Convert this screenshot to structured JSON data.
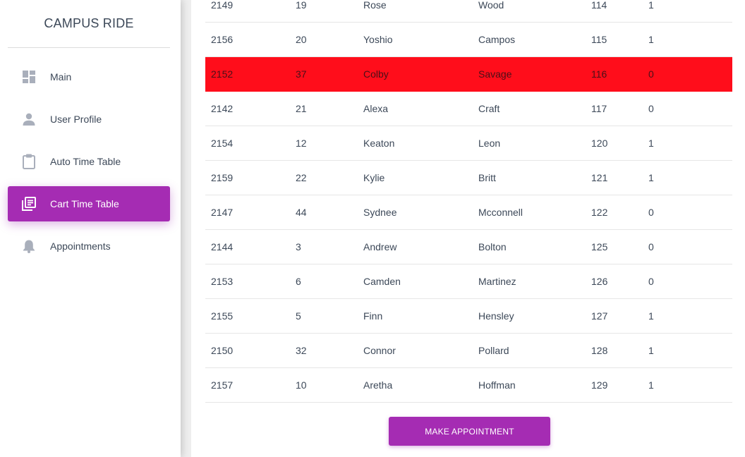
{
  "sidebar": {
    "brand": "CAMPUS RIDE",
    "items": [
      {
        "label": "Main",
        "icon": "dashboard-icon",
        "active": false
      },
      {
        "label": "User Profile",
        "icon": "person-icon",
        "active": false
      },
      {
        "label": "Auto Time Table",
        "icon": "clipboard-icon",
        "active": false
      },
      {
        "label": "Cart Time Table",
        "icon": "library-books-icon",
        "active": true
      },
      {
        "label": "Appointments",
        "icon": "bell-icon",
        "active": false
      }
    ]
  },
  "table": {
    "highlight_color": "#ff0d1b",
    "rows": [
      [
        "2149",
        "19",
        "Rose",
        "Wood",
        "114",
        "1"
      ],
      [
        "2156",
        "20",
        "Yoshio",
        "Campos",
        "115",
        "1"
      ],
      [
        "2152",
        "37",
        "Colby",
        "Savage",
        "116",
        "0"
      ],
      [
        "2142",
        "21",
        "Alexa",
        "Craft",
        "117",
        "0"
      ],
      [
        "2154",
        "12",
        "Keaton",
        "Leon",
        "120",
        "1"
      ],
      [
        "2159",
        "22",
        "Kylie",
        "Britt",
        "121",
        "1"
      ],
      [
        "2147",
        "44",
        "Sydnee",
        "Mcconnell",
        "122",
        "0"
      ],
      [
        "2144",
        "3",
        "Andrew",
        "Bolton",
        "125",
        "0"
      ],
      [
        "2153",
        "6",
        "Camden",
        "Martinez",
        "126",
        "0"
      ],
      [
        "2155",
        "5",
        "Finn",
        "Hensley",
        "127",
        "1"
      ],
      [
        "2150",
        "32",
        "Connor",
        "Pollard",
        "128",
        "1"
      ],
      [
        "2157",
        "10",
        "Aretha",
        "Hoffman",
        "129",
        "1"
      ]
    ],
    "highlighted_row": 2
  },
  "actions": {
    "make_appointment_label": "MAKE APPOINTMENT"
  },
  "colors": {
    "accent": "#a52cb3",
    "text": "#3c4858",
    "icon": "#a9afbb"
  }
}
